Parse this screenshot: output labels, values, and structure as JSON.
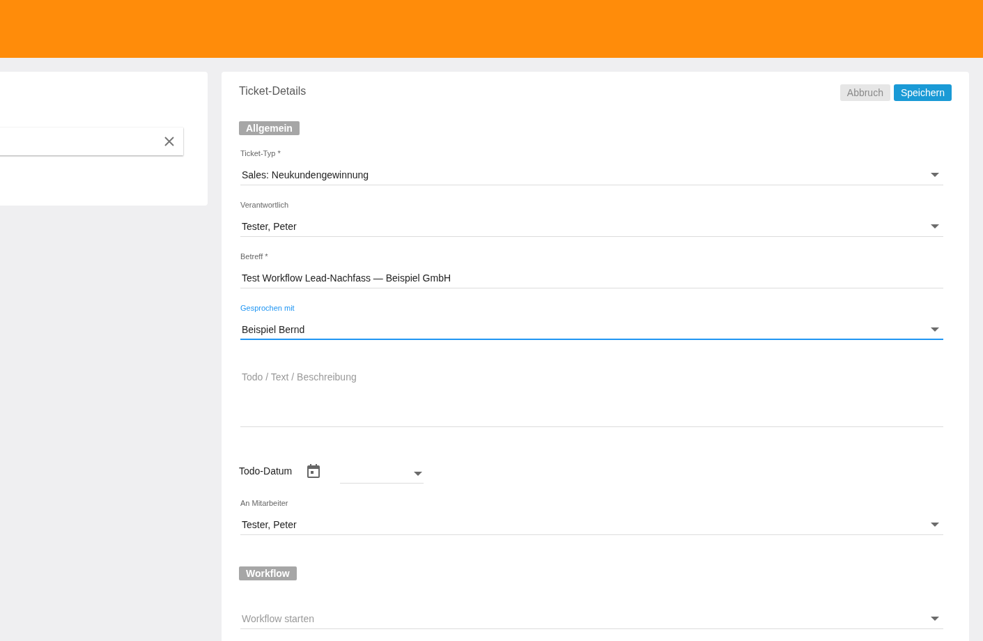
{
  "panel": {
    "title": "Ticket-Details",
    "buttons": [
      {
        "label": "Abbruch",
        "kind": "secondary"
      },
      {
        "label": "Speichern",
        "kind": "primary"
      }
    ]
  },
  "sections": [
    {
      "title": "Allgemein",
      "fields": [
        {
          "kind": "select",
          "label": "Ticket-Typ *",
          "value": "Sales: Neukundengewinnung",
          "focused": false
        },
        {
          "kind": "select",
          "label": "Verantwortlich",
          "value": "Tester, Peter",
          "focused": false
        },
        {
          "kind": "text",
          "label": "Betreff *",
          "value": "Test Workflow Lead-Nachfass — Beispiel GmbH",
          "focused": false
        },
        {
          "kind": "select",
          "label": "Gesprochen mit",
          "value": "Beispiel Bernd",
          "focused": true
        },
        {
          "kind": "textarea",
          "placeholder": "Todo / Text / Beschreibung",
          "focused": false
        },
        {
          "kind": "date",
          "label": "Todo-Datum",
          "focused": false
        },
        {
          "kind": "select",
          "label": "An Mitarbeiter",
          "value": "Tester, Peter",
          "focused": false
        }
      ]
    },
    {
      "title": "Workflow",
      "fields": [
        {
          "kind": "select",
          "placeholder": "Workflow starten",
          "focused": false
        }
      ]
    }
  ]
}
